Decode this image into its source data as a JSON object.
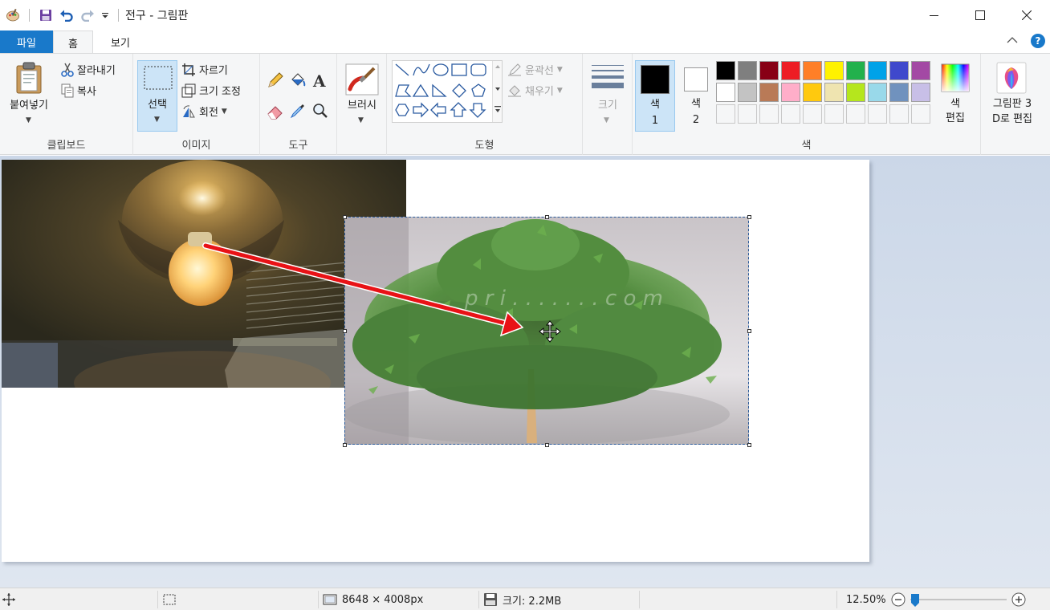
{
  "window": {
    "title": "전구 - 그림판"
  },
  "tabs": {
    "file": "파일",
    "home": "홈",
    "view": "보기"
  },
  "clipboard": {
    "paste": "붙여넣기",
    "cut": "잘라내기",
    "copy": "복사",
    "group_label": "클립보드"
  },
  "image": {
    "select": "선택",
    "crop": "자르기",
    "resize": "크기 조정",
    "rotate": "회전",
    "group_label": "이미지"
  },
  "tools": {
    "group_label": "도구"
  },
  "brushes": {
    "label": "브러시"
  },
  "shapes": {
    "outline": "윤곽선",
    "fill": "채우기",
    "group_label": "도형"
  },
  "size": {
    "label": "크기"
  },
  "colors": {
    "color1_label": "색",
    "color1_num": "1",
    "color2_label": "색",
    "color2_num": "2",
    "edit_colors_1": "색",
    "edit_colors_2": "편집",
    "group_label": "색",
    "color1_value": "#000000",
    "color2_value": "#ffffff",
    "palette_row1": [
      "#000000",
      "#7f7f7f",
      "#880015",
      "#ed1c24",
      "#ff7f27",
      "#fff200",
      "#22b14c",
      "#00a2e8",
      "#3f48cc",
      "#a349a4"
    ],
    "palette_row2": [
      "#ffffff",
      "#c3c3c3",
      "#b97a57",
      "#ffaec9",
      "#ffc90e",
      "#efe4b0",
      "#b5e61d",
      "#99d9ea",
      "#7092be",
      "#c8bfe7"
    ]
  },
  "paint3d": {
    "line1": "그림판 3",
    "line2": "D로 편집"
  },
  "canvas": {
    "watermark": "p r i . . . . . . . c o m"
  },
  "status": {
    "image_size": "8648 × 4008px",
    "file_size": "크기: 2.2MB",
    "zoom": "12.50%",
    "zoom_level": 0.125
  }
}
